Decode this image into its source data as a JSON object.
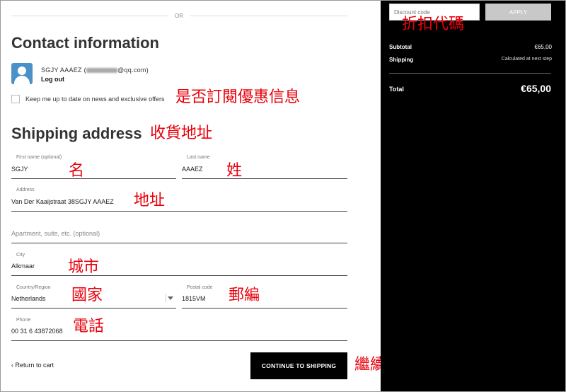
{
  "divider_text": "OR",
  "contact": {
    "title": "Contact information",
    "user_name": "SGJY AAAEZ",
    "user_email_prefix": "(",
    "user_email_suffix": "@qq.com)",
    "logout": "Log out",
    "newsletter_label": "Keep me up to date on news and exclusive offers"
  },
  "shipping": {
    "title": "Shipping address",
    "first_name": {
      "label": "First name (optional)",
      "value": "SGJY"
    },
    "last_name": {
      "label": "Last name",
      "value": "AAAEZ"
    },
    "address": {
      "label": "Address",
      "value": "Van Der Kaaijstraat 38SGJY AAAEZ"
    },
    "apartment": {
      "placeholder": "Apartment, suite, etc. (optional)"
    },
    "city": {
      "label": "City",
      "value": "Alkmaar"
    },
    "country": {
      "label": "Country/Region",
      "value": "Netherlands"
    },
    "postal": {
      "label": "Postal code",
      "value": "1815VM"
    },
    "phone": {
      "label": "Phone",
      "value": "00 31 6 43872068"
    }
  },
  "footer": {
    "back": "‹ Return to cart",
    "continue": "CONTINUE TO SHIPPING"
  },
  "summary": {
    "discount_placeholder": "Discount code",
    "apply": "APPLY",
    "subtotal_label": "Subtotal",
    "subtotal_value": "€65,00",
    "shipping_label": "Shipping",
    "shipping_value": "Calculated at next step",
    "total_label": "Total",
    "total_value": "€65,00"
  },
  "annotations": {
    "discount": "折扣代碼",
    "newsletter": "是否訂閱優惠信息",
    "shipping": "收貨地址",
    "first_name": "名",
    "last_name": "姓",
    "address": "地址",
    "city": "城市",
    "country": "國家",
    "postal": "郵編",
    "phone": "電話",
    "continue": "繼續"
  },
  "colors": {
    "annotation": "#e8000b",
    "sidebar_bg": "#000000",
    "apply_disabled": "#c8c8c8",
    "avatar": "#4a90c9"
  }
}
